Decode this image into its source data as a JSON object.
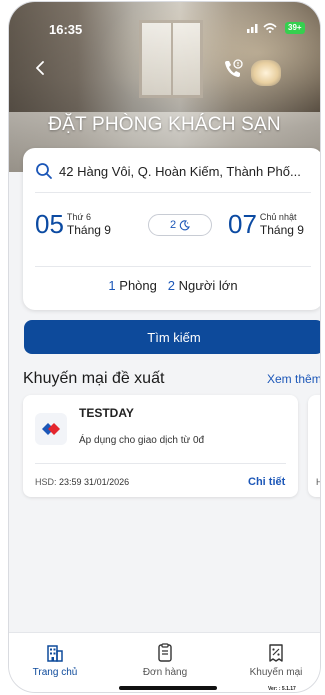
{
  "status_bar": {
    "time": "16:35",
    "battery": "39+"
  },
  "header": {
    "title": "ĐẶT PHÒNG KHÁCH SẠN",
    "back_icon": "chevron-left-icon",
    "hotline_icon": "phone-call-icon"
  },
  "search": {
    "location": "42 Hàng Vôi, Q. Hoàn Kiếm, Thành Phố...",
    "checkin": {
      "day": "05",
      "weekday": "Thứ 6",
      "month": "Tháng 9"
    },
    "nights": "2",
    "checkout": {
      "day": "07",
      "weekday": "Chủ nhật",
      "month": "Tháng 9"
    },
    "rooms": {
      "count": "1",
      "label": "Phòng"
    },
    "guests": {
      "count": "2",
      "label": "Người lớn"
    },
    "button_label": "Tìm kiếm"
  },
  "promotions": {
    "heading": "Khuyến mại đề xuất",
    "see_all": "Xem thêm",
    "items": [
      {
        "code": "TESTDAY",
        "description": "Áp dụng cho giao dịch từ 0đ",
        "expiry_label": "HSD:",
        "expiry": "23:59 31/01/2026",
        "detail_label": "Chi tiết"
      }
    ],
    "next_peek": "H"
  },
  "tabbar": {
    "items": [
      {
        "label": "Trang chủ",
        "icon": "home-building-icon",
        "active": true
      },
      {
        "label": "Đơn hàng",
        "icon": "order-icon",
        "active": false
      },
      {
        "label": "Khuyến mại",
        "icon": "discount-icon",
        "active": false
      }
    ]
  },
  "version": "Ver: : 5.1.17",
  "colors": {
    "primary": "#0d4a9b",
    "accent_text": "#1c57b8",
    "battery": "#35d04f"
  }
}
